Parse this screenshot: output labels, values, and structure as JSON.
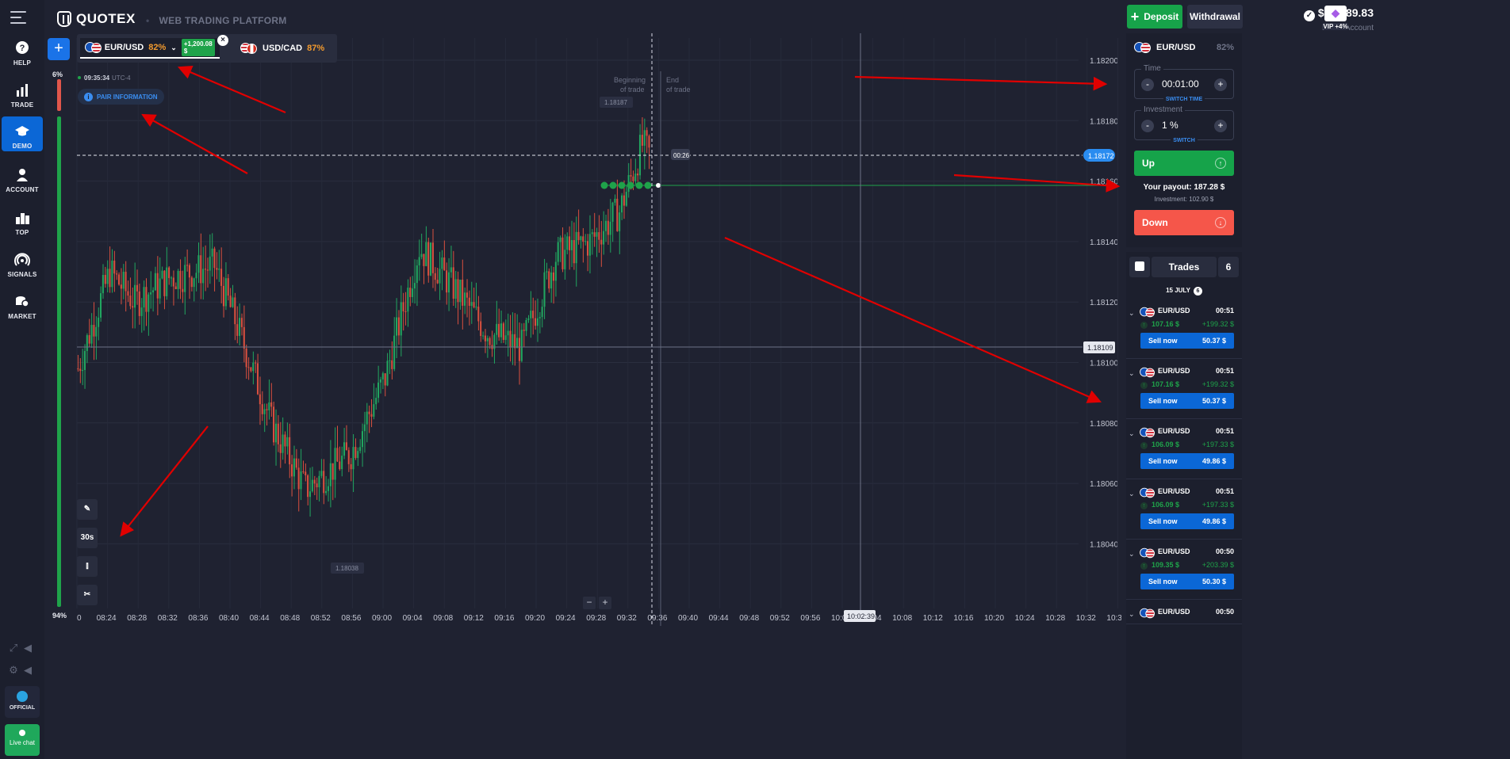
{
  "nav": {
    "items": [
      {
        "label": "HELP",
        "icon": "help-icon"
      },
      {
        "label": "TRADE",
        "icon": "bar-chart-icon"
      },
      {
        "label": "DEMO",
        "icon": "graduation-cap-icon"
      },
      {
        "label": "ACCOUNT",
        "icon": "user-icon"
      },
      {
        "label": "TOP",
        "icon": "podium-icon"
      },
      {
        "label": "SIGNALS",
        "icon": "signal-icon"
      },
      {
        "label": "MARKET",
        "icon": "coins-icon"
      }
    ],
    "official": "OFFICIAL",
    "live_chat": "Live chat"
  },
  "header": {
    "brand": "QUOTEX",
    "subtitle": "WEB TRADING PLATFORM",
    "balance": "$10,289.83",
    "account_type": "Demo Account",
    "vip": "VIP +4%",
    "deposit": "Deposit",
    "withdrawal": "Withdrawal"
  },
  "assets": {
    "active": {
      "name": "EUR/USD",
      "percent": "82%",
      "profit": "+1,200.08 $"
    },
    "other": {
      "name": "USD/CAD",
      "percent": "87%"
    }
  },
  "chart_overlay": {
    "clock": "09:35:34",
    "tz": "UTC-4",
    "pair_info": "PAIR INFORMATION",
    "sentiment_up": "6%",
    "sentiment_down": "94%",
    "timeframe": "30s",
    "beginning": "Beginning of trade",
    "end": "End of trade",
    "countdown": "00:26",
    "current_price": "1.18172",
    "hover_price": "1.18109",
    "hover_time": "10:02:39",
    "high_marker": "1.18187",
    "low_marker": "1.18038",
    "y_labels": [
      "1.18200",
      "1.18180",
      "1.18160",
      "1.18140",
      "1.18120",
      "1.18100",
      "1.18080",
      "1.18060",
      "1.18040"
    ],
    "x_labels": [
      "0",
      "08:24",
      "08:28",
      "08:32",
      "08:36",
      "08:40",
      "08:44",
      "08:48",
      "08:52",
      "08:56",
      "09:00",
      "09:04",
      "09:08",
      "09:12",
      "09:16",
      "09:20",
      "09:24",
      "09:28",
      "09:32",
      "09:36",
      "09:40",
      "09:44",
      "09:48",
      "09:52",
      "09:56",
      "10:00",
      "10:04",
      "10:08",
      "10:12",
      "10:16",
      "10:20",
      "10:24",
      "10:28",
      "10:32",
      "10:3"
    ]
  },
  "panel": {
    "asset": "EUR/USD",
    "percent": "82%",
    "time_label": "Time",
    "time_value": "00:01:00",
    "time_switch": "SWITCH TIME",
    "invest_label": "Investment",
    "invest_value": "1 %",
    "invest_switch": "SWITCH",
    "up": "Up",
    "down": "Down",
    "payout_label": "Your payout:",
    "payout_value": "187.28 $",
    "investment_line": "Investment: 102.90 $"
  },
  "trades": {
    "label": "Trades",
    "count": "6",
    "date": "15 JULY",
    "date_count": "6",
    "items": [
      {
        "asset": "EUR/USD",
        "time": "00:51",
        "investment": "107.16 $",
        "gain": "+199.32 $",
        "sell": "Sell now",
        "sell_value": "50.37 $"
      },
      {
        "asset": "EUR/USD",
        "time": "00:51",
        "investment": "107.16 $",
        "gain": "+199.32 $",
        "sell": "Sell now",
        "sell_value": "50.37 $"
      },
      {
        "asset": "EUR/USD",
        "time": "00:51",
        "investment": "106.09 $",
        "gain": "+197.33 $",
        "sell": "Sell now",
        "sell_value": "49.86 $"
      },
      {
        "asset": "EUR/USD",
        "time": "00:51",
        "investment": "106.09 $",
        "gain": "+197.33 $",
        "sell": "Sell now",
        "sell_value": "49.86 $"
      },
      {
        "asset": "EUR/USD",
        "time": "00:50",
        "investment": "109.35 $",
        "gain": "+203.39 $",
        "sell": "Sell now",
        "sell_value": "50.30 $"
      },
      {
        "asset": "EUR/USD",
        "time": "00:50",
        "investment": "",
        "gain": "",
        "sell": "",
        "sell_value": ""
      }
    ]
  },
  "colors": {
    "up_green": "#16a34a",
    "down_red": "#f5564a",
    "accent_blue": "#0b67d6",
    "annotation_red": "#e00000"
  }
}
